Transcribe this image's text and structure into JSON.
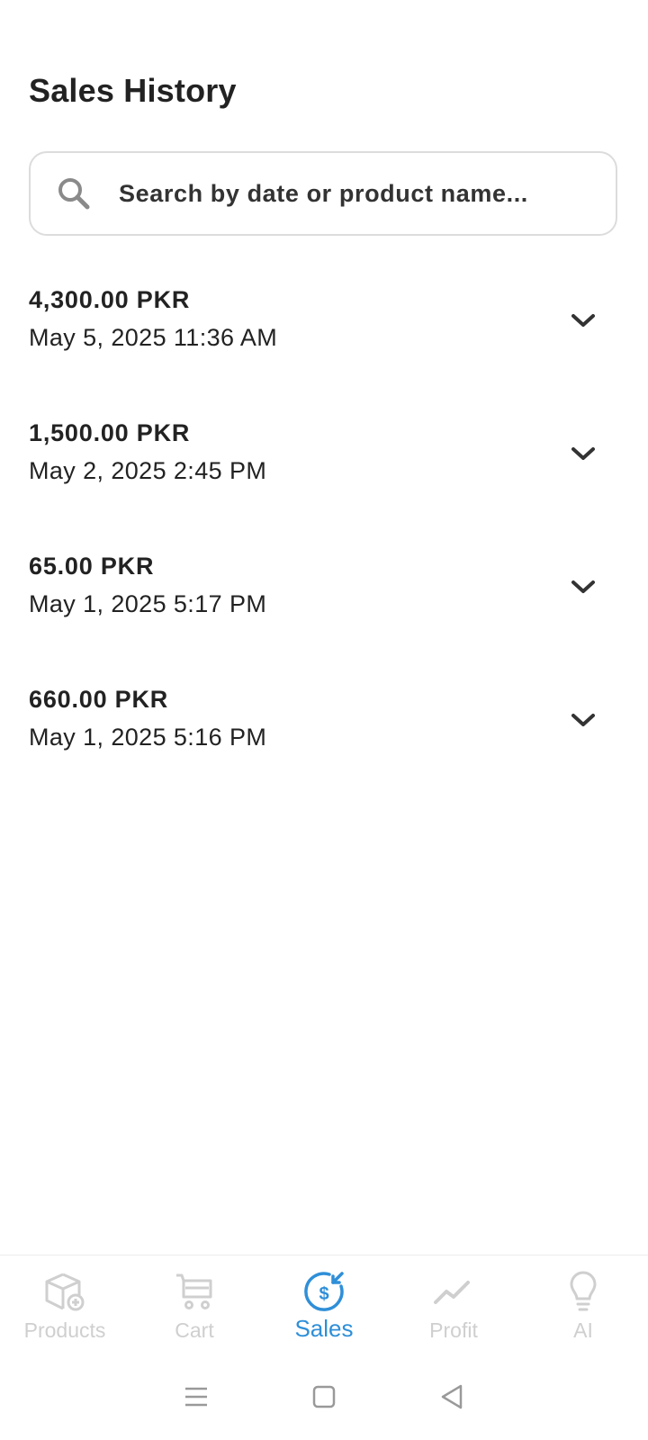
{
  "header": {
    "title": "Sales History"
  },
  "search": {
    "placeholder": "Search by date or product name..."
  },
  "sales": [
    {
      "amount": "4,300.00 PKR",
      "date": "May 5, 2025 11:36 AM"
    },
    {
      "amount": "1,500.00 PKR",
      "date": "May 2, 2025 2:45 PM"
    },
    {
      "amount": "65.00 PKR",
      "date": "May 1, 2025 5:17 PM"
    },
    {
      "amount": "660.00 PKR",
      "date": "May 1, 2025 5:16 PM"
    }
  ],
  "nav": {
    "items": [
      {
        "label": "Products",
        "icon": "box-add-icon",
        "active": false
      },
      {
        "label": "Cart",
        "icon": "cart-icon",
        "active": false
      },
      {
        "label": "Sales",
        "icon": "dollar-refresh-icon",
        "active": true
      },
      {
        "label": "Profit",
        "icon": "trend-line-icon",
        "active": false
      },
      {
        "label": "AI",
        "icon": "lightbulb-icon",
        "active": false
      }
    ]
  },
  "system_nav": {
    "icons": [
      "menu-icon",
      "home-square-icon",
      "back-triangle-icon"
    ]
  },
  "colors": {
    "accent": "#2f8fd8",
    "inactive": "#cfcfcf",
    "text": "#222222",
    "border": "#dcdcdc"
  }
}
